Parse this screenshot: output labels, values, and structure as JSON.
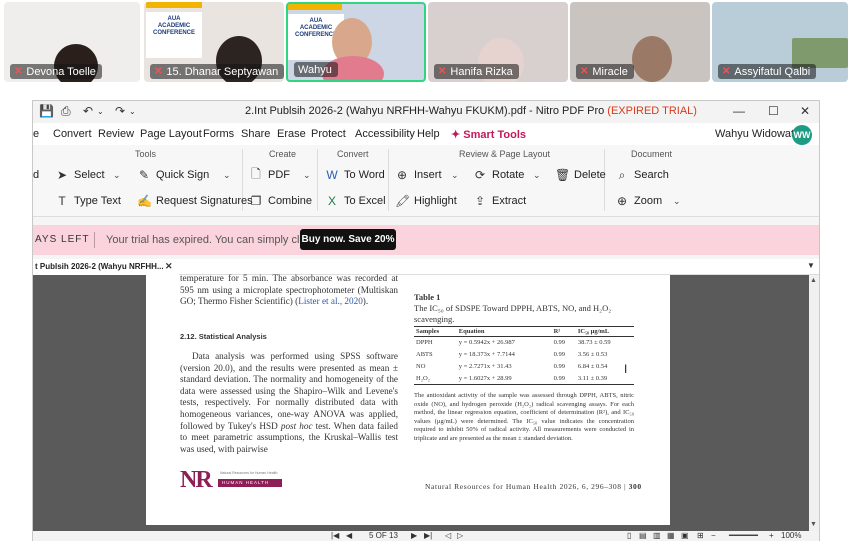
{
  "participants": [
    {
      "name": "Devona Toelle"
    },
    {
      "name": "15. Dhanar Septyawan"
    },
    {
      "name": "Wahyu"
    },
    {
      "name": "Hanifa Rizka"
    },
    {
      "name": "Miracle"
    },
    {
      "name": "Assyifatul Qalbi"
    }
  ],
  "conference_banner": [
    "AUA",
    "ACADEMIC",
    "CONFERENCE"
  ],
  "window": {
    "title": "2.Int Publsih 2026-2 (Wahyu NRFHH-Wahyu FKUKM).pdf - Nitro PDF Pro",
    "trial": "(EXPIRED TRIAL)",
    "minimize": "—",
    "maximize": "☐",
    "close": "✕"
  },
  "menu": {
    "items": [
      "e",
      "Convert",
      "Review",
      "Page Layout",
      "Forms",
      "Share",
      "Erase",
      "Protect",
      "Accessibility",
      "Help"
    ],
    "smart_tools": "Smart Tools",
    "user_name": "Wahyu Widowati",
    "user_initials": "WW"
  },
  "ribbon": {
    "groups": {
      "tools": "Tools",
      "create": "Create",
      "convert": "Convert",
      "review": "Review & Page Layout",
      "document": "Document"
    },
    "buttons": {
      "partial": "d",
      "select": "Select",
      "quick_sign": "Quick Sign",
      "type_text": "Type Text",
      "request_signatures": "Request Signatures",
      "pdf": "PDF",
      "combine": "Combine",
      "to_word": "To Word",
      "to_excel": "To Excel",
      "insert": "Insert",
      "rotate": "Rotate",
      "delete": "Delete",
      "highlight": "Highlight",
      "extract": "Extract",
      "search": "Search",
      "zoom": "Zoom"
    }
  },
  "trial_banner": {
    "days_left": "AYS LEFT",
    "message": "Your trial has expired. You can simply click to",
    "buy_button": "Buy now. Save 20%"
  },
  "doc_tab": {
    "label": "t Publsih 2026-2 (Wahyu NRFHH...",
    "close": "✕"
  },
  "pdf_page": {
    "top_text": "temperature for 5 min. The absorbance was recorded at 595 nm using a microplate spectrophotometer (Multiskan GO; Thermo Fisher Scientific) (",
    "top_cite": "Lister et al., 2020",
    "top_text_end": ").",
    "section_heading": "2.12. Statistical Analysis",
    "body_start": "Data analysis was performed using SPSS software (version 20.0), and the results were presented as mean ± standard deviation. The normality and homogeneity of the data were assessed using the Shapiro–Wilk and Levene's tests, respectively. For normally distributed data with homogeneous variances, one-way ANOVA was applied, followed by Tukey's HSD ",
    "body_italic": "post hoc",
    "body_end": " test. When data failed to meet parametric assumptions, the Kruskal–Wallis test was used, with pairwise",
    "table_label": "Table 1",
    "table_caption": "The IC₅₀ of SDSPE Toward DPPH, ABTS, NO, and H₂O₂ scavenging.",
    "table_headers": [
      "Samples",
      "Equation",
      "R²",
      "IC₅₀ µg/mL"
    ],
    "table_rows": [
      [
        "DPPH",
        "y = 0.5942x + 26.987",
        "0.99",
        "38.73 ± 0.59"
      ],
      [
        "ABTS",
        "y = 18.373x + 7.7144",
        "0.99",
        "3.56 ± 0.53"
      ],
      [
        "NO",
        "y = 2.7271x + 31.43",
        "0.99",
        "6.84 ± 0.54"
      ],
      [
        "H₂O₂",
        "y = 1.6027x + 28.99",
        "0.99",
        "3.11 ± 0.39"
      ]
    ],
    "table_note": "The antioxidant activity of the sample was assessed through DPPH, ABTS, nitric oxide (NO), and hydrogen peroxide (H₂O₂) radical scavenging assays. For each method, the linear regression equation, coefficient of determination (R²), and IC₅₀ values (µg/mL) were determined. The IC₅₀ value indicates the concentration required to inhibit 50% of radical activity. All measurements were conducted in triplicate and are presented as the mean ± standard deviation.",
    "logo_letters": "NR",
    "logo_bar": "HUMAN HEALTH",
    "logo_sub": "Natural Resources for Human Health",
    "footer": "Natural Resources for Human Health 2026, 6, 296–308",
    "page_number": "300"
  },
  "status": {
    "nav_first": "|◀",
    "nav_prev": "◀",
    "page_info": "5 OF 13",
    "nav_next": "▶",
    "nav_last": "▶|",
    "zoom": "100%",
    "zoom_minus": "−",
    "zoom_plus": "+"
  }
}
